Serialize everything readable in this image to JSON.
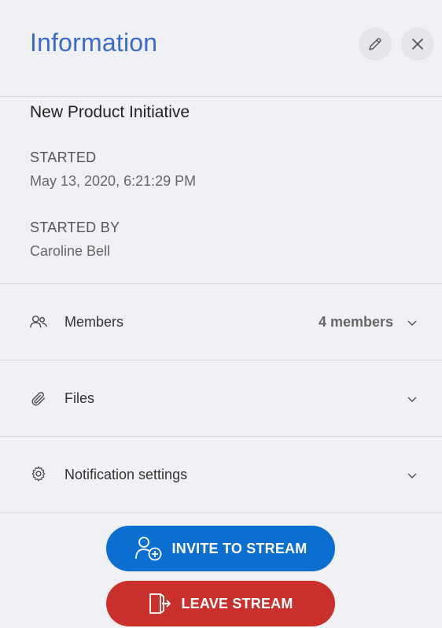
{
  "header": {
    "title": "Information",
    "edit_icon": "pencil-icon",
    "close_icon": "close-icon"
  },
  "details": {
    "stream_name": "New Product Initiative",
    "started_label": "STARTED",
    "started_value": "May 13, 2020, 6:21:29 PM",
    "started_by_label": "STARTED BY",
    "started_by_value": "Caroline Bell"
  },
  "sections": {
    "members": {
      "label": "Members",
      "count": "4 members",
      "icon": "people-icon"
    },
    "files": {
      "label": "Files",
      "icon": "paperclip-icon"
    },
    "notifications": {
      "label": "Notification settings",
      "icon": "gear-icon"
    }
  },
  "actions": {
    "invite_label": "INVITE TO STREAM",
    "leave_label": "LEAVE STREAM"
  },
  "colors": {
    "title": "#3a6cc7",
    "invite_button": "#0b6fd1",
    "leave_button": "#c9302c",
    "background": "#f0f1f4"
  }
}
